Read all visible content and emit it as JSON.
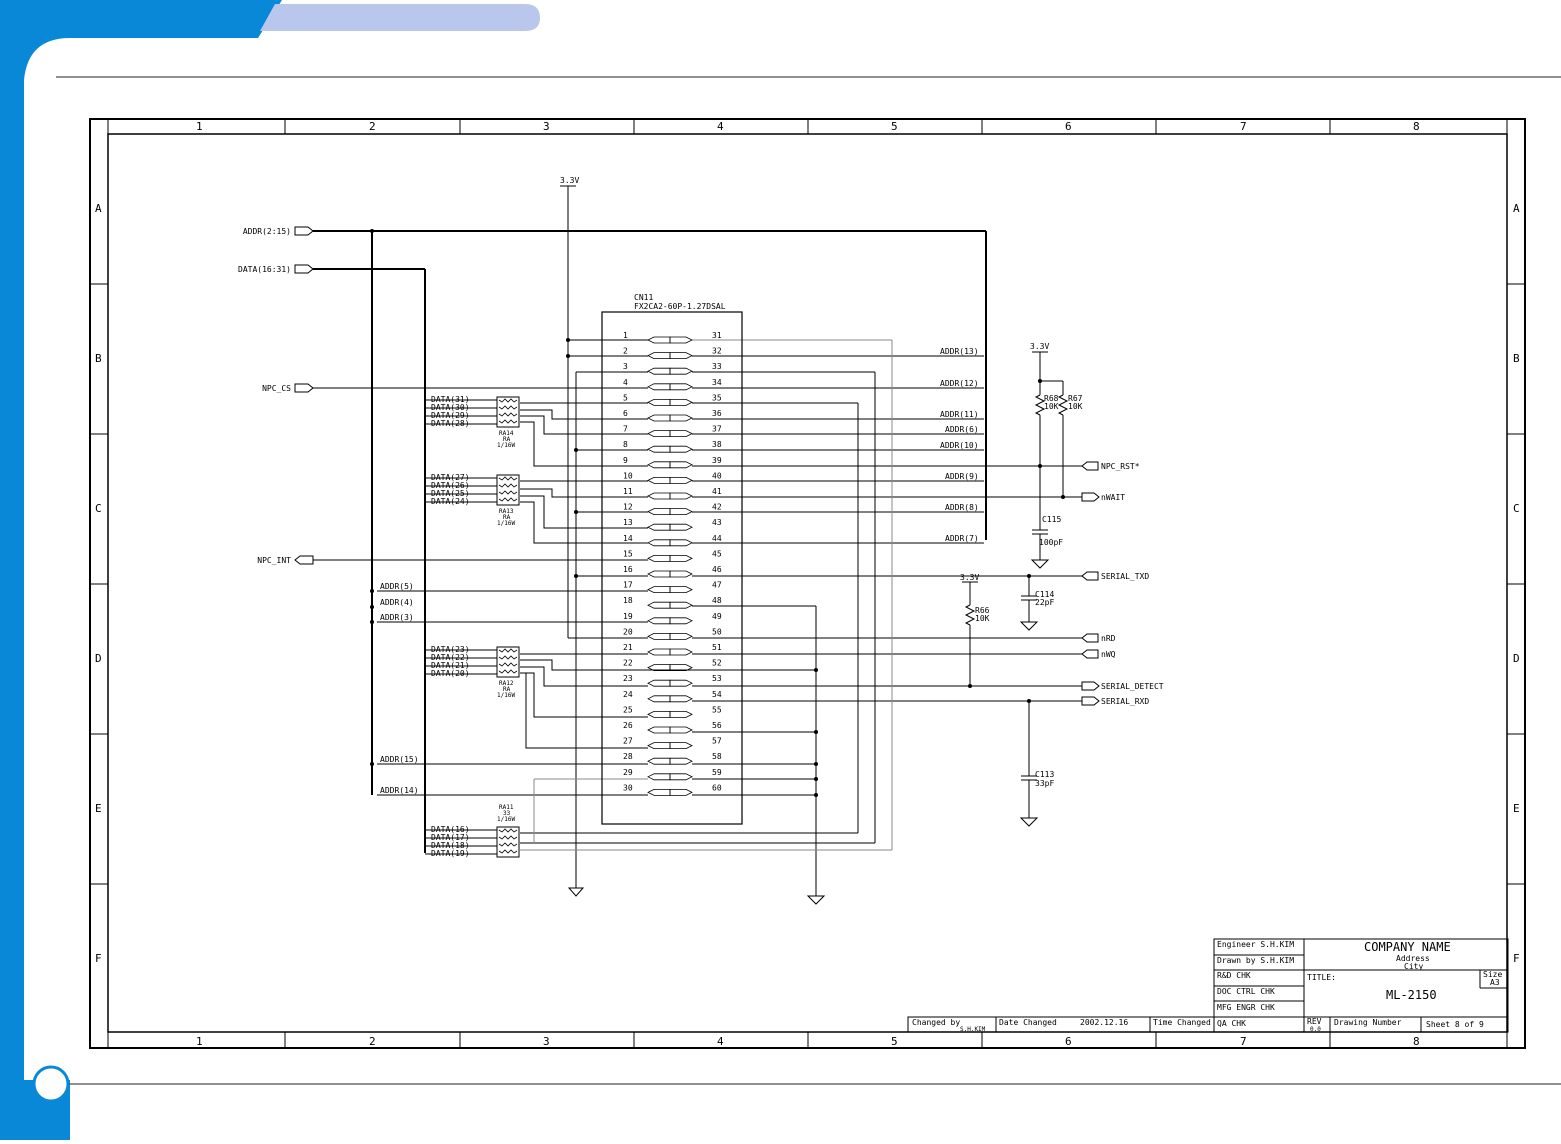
{
  "schematic": {
    "frame": {
      "columns": [
        "1",
        "2",
        "3",
        "4",
        "5",
        "6",
        "7",
        "8"
      ],
      "rows": [
        "A",
        "B",
        "C",
        "D",
        "E",
        "F"
      ]
    },
    "power_label": "3.3V",
    "connector": {
      "ref": "CN11",
      "part": "FX2CA2-60P-1.27DSAL",
      "left_pins": [
        "1",
        "2",
        "3",
        "4",
        "5",
        "6",
        "7",
        "8",
        "9",
        "10",
        "11",
        "12",
        "13",
        "14",
        "15",
        "16",
        "17",
        "18",
        "19",
        "20",
        "21",
        "22",
        "23",
        "24",
        "25",
        "26",
        "27",
        "28",
        "29",
        "30"
      ],
      "right_pins": [
        "31",
        "32",
        "33",
        "34",
        "35",
        "36",
        "37",
        "38",
        "39",
        "40",
        "41",
        "42",
        "43",
        "44",
        "45",
        "46",
        "47",
        "48",
        "49",
        "50",
        "51",
        "52",
        "53",
        "54",
        "55",
        "56",
        "57",
        "58",
        "59",
        "60"
      ]
    },
    "ports_left": [
      {
        "name": "ADDR(2:15)"
      },
      {
        "name": "DATA(16:31)"
      },
      {
        "name": "NPC_CS"
      },
      {
        "name": "NPC_INT"
      }
    ],
    "ports_right": [
      {
        "name": "NPC_RST*"
      },
      {
        "name": "nWAIT"
      },
      {
        "name": "SERIAL_TXD"
      },
      {
        "name": "nRD"
      },
      {
        "name": "nWQ"
      },
      {
        "name": "SERIAL_DETECT"
      },
      {
        "name": "SERIAL_RXD"
      }
    ],
    "addr_right_labels": [
      "ADDR(13)",
      "ADDR(12)",
      "ADDR(11)",
      "ADDR(6)",
      "ADDR(10)",
      "ADDR(9)",
      "ADDR(8)",
      "ADDR(7)"
    ],
    "addr_left_labels": [
      "ADDR(5)",
      "ADDR(4)",
      "ADDR(3)",
      "ADDR(15)",
      "ADDR(14)"
    ],
    "data_group1": [
      "DATA(31)",
      "DATA(30)",
      "DATA(29)",
      "DATA(28)"
    ],
    "data_group2": [
      "DATA(27)",
      "DATA(26)",
      "DATA(25)",
      "DATA(24)"
    ],
    "data_group3": [
      "DATA(23)",
      "DATA(22)",
      "DATA(21)",
      "DATA(20)"
    ],
    "data_group4": [
      "DATA(16)",
      "DATA(17)",
      "DATA(18)",
      "DATA(19)"
    ],
    "rpacks": [
      {
        "l1": "RA14",
        "l2": "RA",
        "l3": "1/16W"
      },
      {
        "l1": "RA13",
        "l2": "RA",
        "l3": "1/16W"
      },
      {
        "l1": "RA12",
        "l2": "RA",
        "l3": "1/16W"
      },
      {
        "l1": "RA11",
        "l2": "33",
        "l3": "1/16W"
      }
    ],
    "components": {
      "r68": {
        "ref": "R68",
        "val": "10K"
      },
      "r67": {
        "ref": "R67",
        "val": "10K"
      },
      "r66": {
        "ref": "R66",
        "val": "10K"
      },
      "c115": {
        "ref": "C115",
        "val": "100pF"
      },
      "c114": {
        "ref": "C114",
        "val": "22pF"
      },
      "c113": {
        "ref": "C113",
        "val": "33pF"
      }
    },
    "title_block": {
      "engineer": "Engineer S.H.KIM",
      "drawn_by": "Drawn by S.H.KIM",
      "rd_chk": "R&D CHK",
      "doc_ctrl": "DOC CTRL CHK",
      "mfg": "MFG ENGR CHK",
      "qa": "QA CHK",
      "company": "COMPANY NAME",
      "address": "Address",
      "city": "City",
      "title_label": "TITLE:",
      "title": "ML-2150",
      "size_label": "Size",
      "size": "A3",
      "changed_by_label": "Changed by",
      "changed_by": "S.H.KIM",
      "date_changed_label": "Date Changed",
      "date_changed": "2002.12.16",
      "time_changed_label": "Time Changed",
      "rev_label": "REV",
      "rev": "0.0",
      "drawing_number_label": "Drawing Number",
      "sheet": "Sheet 8 of 9"
    }
  }
}
